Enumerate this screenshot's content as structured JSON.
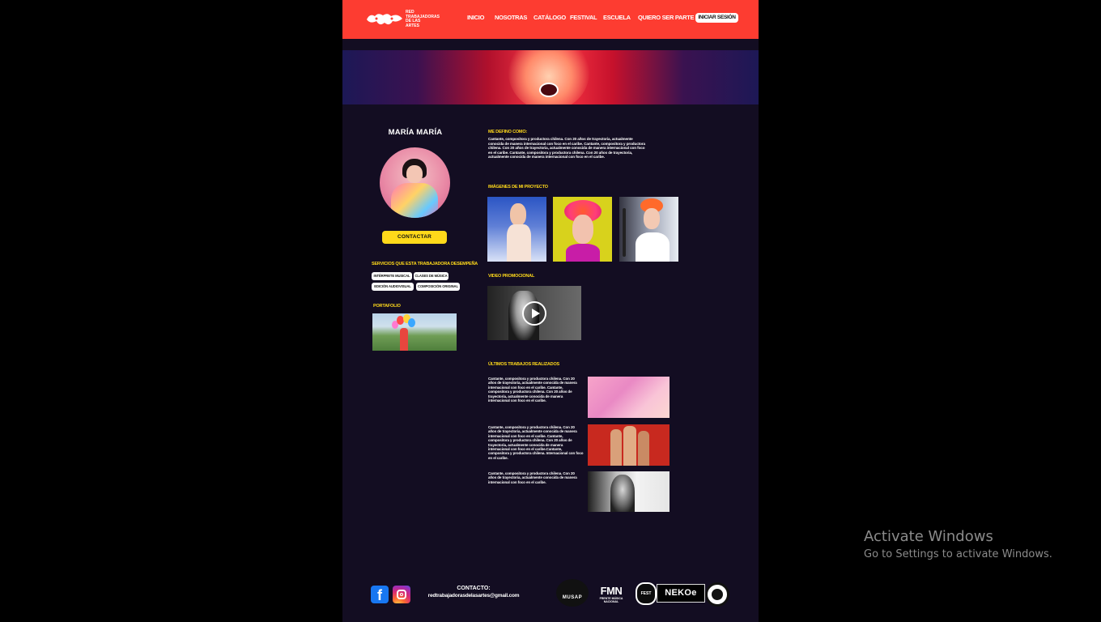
{
  "header": {
    "logo_text": "RED TRABAJADORAS DE LAS ARTES",
    "nav": [
      "INICIO",
      "NOSOTRAS",
      "CATÁLOGO",
      "FESTIVAL",
      "ESCUELA",
      "QUIERO SER PARTE"
    ],
    "login_label": "INICIAR SESIÓN"
  },
  "profile": {
    "name": "MARÍA MARÍA",
    "contact_label": "CONTACTAR",
    "services_title": "SERVICIOS QUE ESTA TRABAJADORA DESEMPEÑA",
    "services": [
      "INTÉRPRETE MUSICAL",
      "CLASES DE MÚSICA",
      "EDICIÓN AUDIOVISUAL",
      "COMPOSICIÓN ORIGINAL"
    ],
    "portfolio_title": "PORTAFOLIO"
  },
  "main": {
    "define_title": "ME DEFINO COMO:",
    "define_text": "Cantante, compositora y productora chilena. Con 20 años de trayectoria, actualmente conocida de manera internacional con foco en el caribe. Cantante, compositora y productora chilena. Con 20 años de trayectoria, actualmente conocida de manera internacional con foco en el caribe. Cantante, compositora y productora chilena. Con 20 años de trayectoria, actualmente conocida de manera internacional con foco en el caribe.",
    "images_title": "IMÁGENES DE MI PROYECTO",
    "video_title": "VIDEO PROMOCIONAL",
    "works_title": "ÚLTIMOS TRABAJOS REALIZADOS",
    "works": [
      "Cantante, compositora y productora chilena. Con 20 años de trayectoria, actualmente conocida de manera internacional con foco en el caribe. Cantante, compositora y productora chilena. Con 20 años de trayectoria, actualmente conocida de manera internacional con foco en el caribe.",
      "Cantante, compositora y productora chilena. Con 20 años de trayectoria, actualmente conocida de manera internacional con foco en el caribe. Cantante, compositora y productora chilena. Con 20 años de trayectoria, actualmente conocida de manera internacional con foco en el caribe.Cantante, compositora y productora chilena. Internacional con foco en el caribe.",
      "Cantante, compositora y productora chilena. Con 20 años de trayectoria, actualmente conocida de manera internacional con foco en el caribe."
    ]
  },
  "footer": {
    "contact_label": "CONTACTO:",
    "email": "redtrabajadorasdelasartes@gmail.com",
    "sponsors": [
      "MUSAP",
      "FMN",
      "FEST",
      "NEKOe"
    ],
    "fmn_sub": "FRENTE MÚSICA NACIONAL"
  },
  "os": {
    "activate_title": "Activate Windows",
    "activate_sub": "Go to Settings to activate Windows."
  },
  "colors": {
    "header_bg": "#fd3c31",
    "page_bg": "#130d22",
    "accent": "#ffd91a"
  }
}
